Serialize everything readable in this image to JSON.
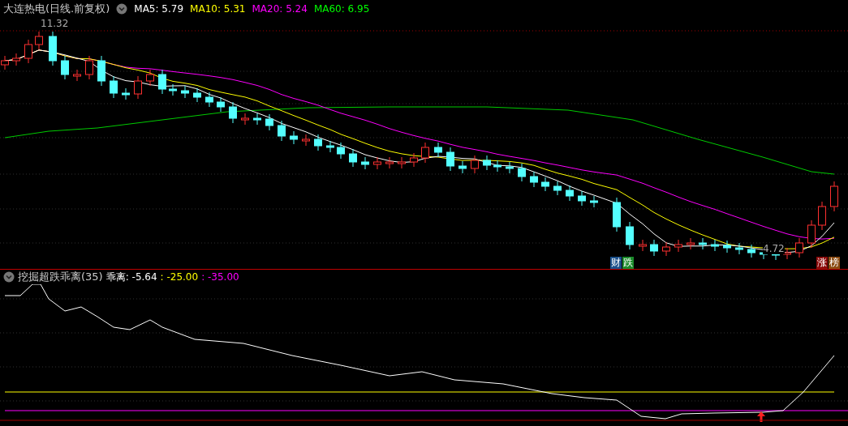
{
  "main_panel": {
    "title": "大连热电(日线.前复权)",
    "ma_legend": [
      {
        "label": "MA5: 5.79",
        "color": "#ffffff"
      },
      {
        "label": "MA10: 5.31",
        "color": "#ffff00"
      },
      {
        "label": "MA20: 5.24",
        "color": "#ff00ff"
      },
      {
        "label": "MA60: 6.95",
        "color": "#00ff00"
      }
    ],
    "high_label": "11.32",
    "low_label": "4.72",
    "badges_left": [
      {
        "label": "财",
        "color": "#1a4f8a"
      },
      {
        "label": "跌",
        "color": "#1a8a2a"
      }
    ],
    "badges_right": [
      {
        "label": "涨",
        "color": "#8a0a0a"
      },
      {
        "label": "榜",
        "color": "#8a4a10"
      }
    ]
  },
  "indicator_panel": {
    "title": "挖掘超跌乖离(35)",
    "values": [
      {
        "label": "乖离: -5.64",
        "color": "#ffffff"
      },
      {
        "label": ": -25.00",
        "color": "#ffff00"
      },
      {
        "label": ": -35.00",
        "color": "#ff00ff"
      }
    ]
  }
}
